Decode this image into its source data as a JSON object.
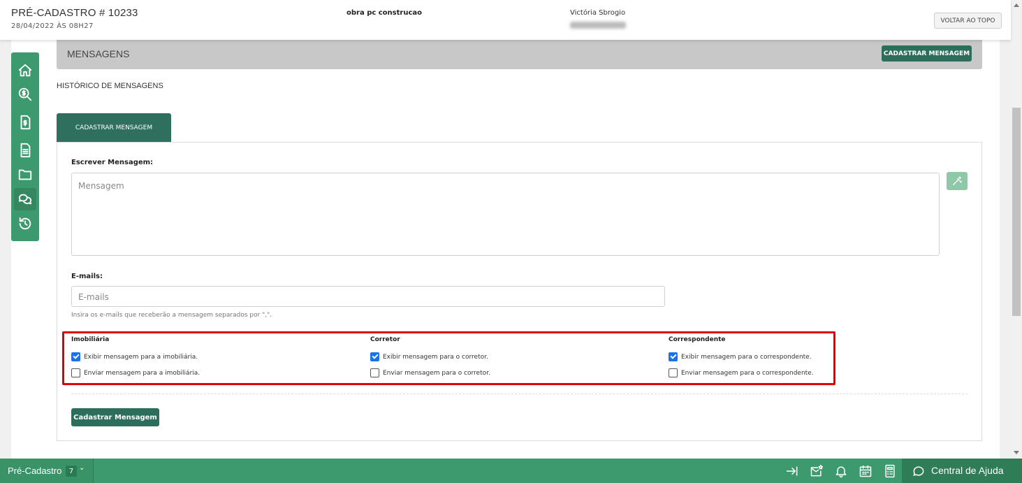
{
  "header": {
    "title": "PRÉ-CADASTRO # 10233",
    "date": "28/04/2022 ÀS 08H27",
    "project": "obra pc construcao",
    "user_name": "Victória Sbrogio",
    "back_to_top_label": "VOLTAR AO TOPO"
  },
  "sidenav": {
    "items": [
      {
        "icon": "home-icon"
      },
      {
        "icon": "search-money-icon"
      },
      {
        "icon": "invoice-icon"
      },
      {
        "icon": "document-icon"
      },
      {
        "icon": "folder-icon"
      },
      {
        "icon": "messages-icon",
        "active": true
      },
      {
        "icon": "history-icon"
      }
    ]
  },
  "messages": {
    "section_title": "MENSAGENS",
    "register_button_label": "CADASTRAR MENSAGEM",
    "history_label": "HISTÓRICO DE MENSAGENS",
    "tab_label": "CADASTRAR MENSAGEM",
    "form": {
      "message_label": "Escrever Mensagem:",
      "message_placeholder": "Mensagem",
      "emails_label": "E-mails:",
      "emails_placeholder": "E-mails",
      "emails_hint": "Insira os e-mails que receberão a mensagem separados por \",\".",
      "groups": [
        {
          "title": "Imobiliária",
          "options": [
            {
              "label": "Exibir mensagem para a imobiliária.",
              "checked": true
            },
            {
              "label": "Enviar mensagem para a imobiliária.",
              "checked": false
            }
          ]
        },
        {
          "title": "Corretor",
          "options": [
            {
              "label": "Exibir mensagem para o corretor.",
              "checked": true
            },
            {
              "label": "Enviar mensagem para o corretor.",
              "checked": false
            }
          ]
        },
        {
          "title": "Correspondente",
          "options": [
            {
              "label": "Exibir mensagem para o correspondente.",
              "checked": true
            },
            {
              "label": "Enviar mensagem para o correspondente.",
              "checked": false
            }
          ]
        }
      ],
      "submit_label": "Cadastrar Mensagem"
    }
  },
  "bottombar": {
    "breadcrumb_label": "Pré-Cadastro",
    "breadcrumb_count": "7",
    "icons": [
      "collapse-icon",
      "mail-star-icon",
      "bell-icon",
      "calendar-icon",
      "calculator-icon"
    ],
    "help_label": "Central de Ajuda"
  },
  "colors": {
    "brand_green": "#3d9a6e",
    "dark_green": "#2c6e5b",
    "highlight_red": "#e00000",
    "checkbox_blue": "#1a73e8"
  }
}
